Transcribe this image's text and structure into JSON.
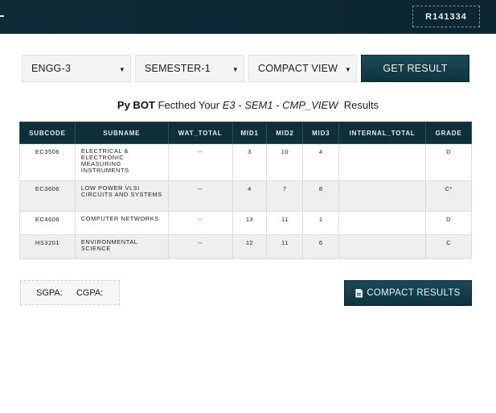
{
  "header": {
    "roll_number": "R141334"
  },
  "controls": {
    "branch": "ENGG-3",
    "semester": "SEMESTER-1",
    "view": "COMPACT VIEW",
    "get_result_label": "GET RESULT"
  },
  "caption": {
    "bot": "Py BOT",
    "fetched": " Fecthed Your ",
    "code": "E3 - SEM1 - CMP_VIEW",
    "results": "  Results"
  },
  "table": {
    "headers": [
      "SUBCODE",
      "SUBNAME",
      "WAT_TOTAL",
      "MID1",
      "MID2",
      "MID3",
      "INTERNAL_TOTAL",
      "GRADE"
    ],
    "rows": [
      {
        "subcode": "EC3506",
        "subname": "ELECTRICAL & ELECTRONIC MEASURING INSTRUMENTS",
        "wat_total": "--",
        "mid1": "3",
        "mid2": "10",
        "mid3": "4",
        "internal_total": "",
        "grade": "D"
      },
      {
        "subcode": "EC3606",
        "subname": "LOW POWER VLSI CIRCUITS AND SYSTEMS",
        "wat_total": "--",
        "mid1": "4",
        "mid2": "7",
        "mid3": "8",
        "internal_total": "",
        "grade": "C*"
      },
      {
        "subcode": "EC4606",
        "subname": "COMPUTER NETWORKS",
        "wat_total": "--",
        "mid1": "13",
        "mid2": "11",
        "mid3": "1",
        "internal_total": "",
        "grade": "D"
      },
      {
        "subcode": "HS3201",
        "subname": "ENVIRONMENTAL SCIENCE",
        "wat_total": "--",
        "mid1": "12",
        "mid2": "11",
        "mid3": "6",
        "internal_total": "",
        "grade": "C"
      }
    ]
  },
  "summary": {
    "sgpa_label": "SGPA:",
    "cgpa_label": "CGPA:",
    "compact_results_label": "COMPACT RESULTS"
  }
}
